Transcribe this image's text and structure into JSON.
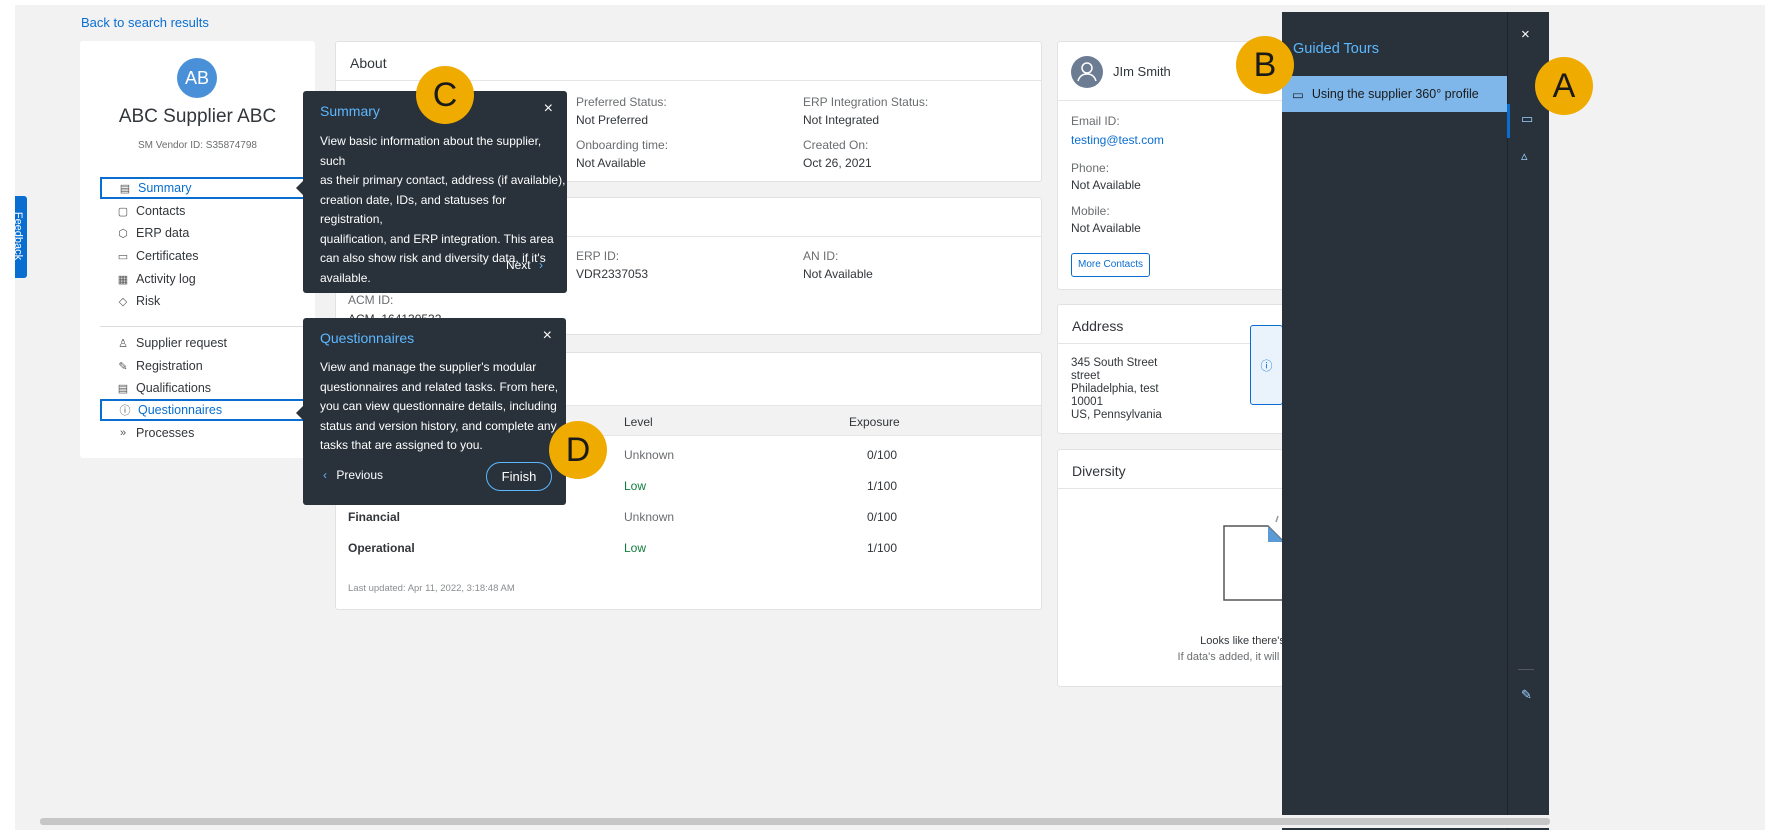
{
  "back_link": "Back to search results",
  "feedback_tab": "Feedback",
  "supplier": {
    "initials": "AB",
    "name": "ABC Supplier ABC",
    "vendor_id": "SM Vendor ID:  S35874798"
  },
  "nav": {
    "primary": [
      {
        "label": "Summary",
        "icon": "clipboard-icon"
      },
      {
        "label": "Contacts",
        "icon": "contacts-icon"
      },
      {
        "label": "ERP data",
        "icon": "database-icon"
      },
      {
        "label": "Certificates",
        "icon": "certificate-icon"
      },
      {
        "label": "Activity log",
        "icon": "activity-log-icon"
      },
      {
        "label": "Risk",
        "icon": "risk-icon"
      }
    ],
    "secondary": [
      {
        "label": "Supplier request",
        "icon": "supplier-request-icon"
      },
      {
        "label": "Registration",
        "icon": "registration-icon"
      },
      {
        "label": "Qualifications",
        "icon": "qualifications-icon"
      },
      {
        "label": "Questionnaires",
        "icon": "questionnaire-icon"
      },
      {
        "label": "Processes",
        "icon": "processes-icon"
      }
    ]
  },
  "about": {
    "title": "About",
    "preferred_label": "Preferred Status:",
    "preferred_value": "Not Preferred",
    "erp_integration_label": "ERP Integration Status:",
    "erp_integration_value": "Not Integrated",
    "onboarding_label": "Onboarding time:",
    "onboarding_value": "Not Available",
    "created_label": "Created On:",
    "created_value": "Oct 26, 2021"
  },
  "ids": {
    "erp_label": "ERP ID:",
    "erp_value": "VDR2337053",
    "an_label": "AN ID:",
    "an_value": "Not Available",
    "acm_label": "ACM ID:",
    "acm_value": "ACM_164130532"
  },
  "risk": {
    "col_level": "Level",
    "col_exposure": "Exposure",
    "rows": [
      {
        "name": "",
        "level": "Unknown",
        "exposure": "0/100"
      },
      {
        "name": "",
        "level": "Low",
        "exposure": "1/100"
      },
      {
        "name": "Financial",
        "level": "Unknown",
        "exposure": "0/100"
      },
      {
        "name": "Operational",
        "level": "Low",
        "exposure": "1/100"
      }
    ],
    "updated": "Last updated: Apr 11, 2022, 3:18:48 AM"
  },
  "contact": {
    "name": "JIm Smith",
    "email_label": "Email ID:",
    "email_value": "testing@test.com",
    "phone_label": "Phone:",
    "phone_value": "Not Available",
    "mobile_label": "Mobile:",
    "mobile_value": "Not Available",
    "more_button": "More Contacts"
  },
  "address": {
    "title": "Address",
    "lines": [
      "345 South Street",
      "street",
      "Philadelphia, test",
      "10001",
      "US, Pennsylvania"
    ]
  },
  "diversity": {
    "title": "Diversity",
    "empty_line1": "Looks like there's n",
    "empty_line2": "If data's added, it will sh"
  },
  "popovers": {
    "summary": {
      "title": "Summary",
      "body": [
        "View basic information about the supplier, such",
        "as their primary contact, address (if available),",
        "creation date, IDs, and statuses for registration,",
        "qualification, and ERP integration. This area",
        "can also show risk and diversity data, if it's",
        "available."
      ],
      "next": "Next"
    },
    "questionnaires": {
      "title": "Questionnaires",
      "body": [
        "View and manage the supplier's modular",
        "questionnaires and related tasks. From here,",
        "you can view questionnaire details, including",
        "status and version history, and complete any",
        "tasks that are assigned to you."
      ],
      "previous": "Previous",
      "finish": "Finish"
    }
  },
  "guided_tours": {
    "title": "Guided Tours",
    "item": "Using the supplier 360° profile"
  },
  "callouts": {
    "a": "A",
    "b": "B",
    "c": "C",
    "d": "D"
  },
  "colors": {
    "accent": "#0a6ed1",
    "panel": "#29313a",
    "callout": "#f0ab00",
    "positive": "#107e3e"
  }
}
